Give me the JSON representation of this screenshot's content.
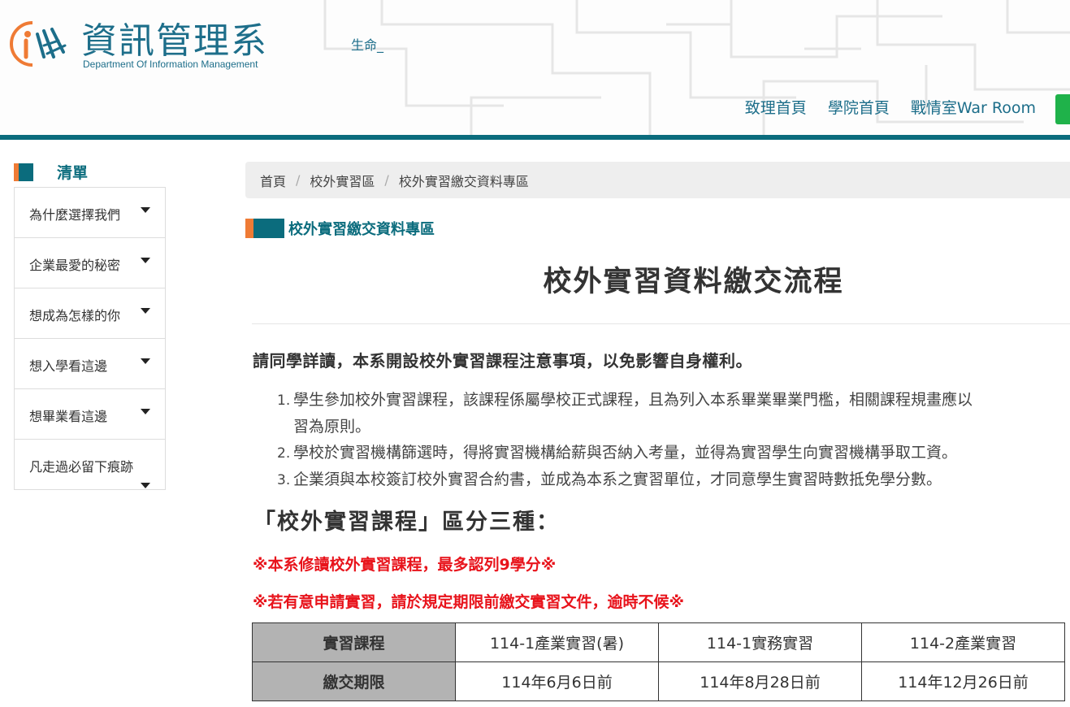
{
  "header": {
    "logo_title": "資訊管理系",
    "logo_subtitle": "Department Of Information Management",
    "marquee": "生命_",
    "nav": [
      "致理首頁",
      "學院首頁",
      "戰情室War Room"
    ],
    "colors": {
      "teal": "#0b6c7d",
      "orange": "#ef7b35",
      "green": "#1fb24a"
    }
  },
  "sidebar": {
    "title": "清單",
    "items": [
      {
        "label": "為什麼選擇我們",
        "icon": "caret-down-icon"
      },
      {
        "label": "企業最愛的秘密",
        "icon": "caret-down-icon"
      },
      {
        "label": "想成為怎樣的你",
        "icon": "caret-down-icon"
      },
      {
        "label": "想入學看這邊",
        "icon": "caret-down-icon"
      },
      {
        "label": "想畢業看這邊",
        "icon": "caret-down-icon"
      },
      {
        "label": "凡走過必留下痕跡",
        "icon": "caret-down-icon"
      }
    ]
  },
  "breadcrumb": {
    "items": [
      "首頁",
      "校外實習區",
      "校外實習繳交資料專區"
    ],
    "separator": "/"
  },
  "section_title": "校外實習繳交資料專區",
  "main": {
    "title": "校外實習資料繳交流程",
    "intro": "請同學詳讀，本系開設校外實習課程注意事項，以免影響自身權利。",
    "notes": [
      {
        "num": "1.",
        "line1": "學生參加校外實習課程，該課程係屬學校正式課程，且為列入本系畢業畢業門檻，相關課程規畫應以",
        "line2": "習為原則。"
      },
      {
        "num": "2.",
        "line1": "學校於實習機構篩選時，得將實習機構給薪與否納入考量，並得為實習學生向實習機構爭取工資。"
      },
      {
        "num": "3.",
        "line1": "企業須與本校簽訂校外實習合約書，並成為本系之實習單位，才同意學生實習時數抵免學分數。"
      }
    ],
    "subheading": "「校外實習課程」區分三種：",
    "warning1": "※本系修讀校外實習課程，最多認列9學分※",
    "warning2": "※若有意申請實習，請於規定期限前繳交實習文件，逾時不候※",
    "warning_color": "#e8131b"
  },
  "schedule_table": {
    "rows": [
      {
        "header": "實習課程",
        "cells": [
          "114-1產業實習(暑)",
          "114-1實務實習",
          "114-2產業實習"
        ]
      },
      {
        "header": "繳交期限",
        "cells": [
          "114年6月6日前",
          "114年8月28日前",
          "114年12月26日前"
        ]
      }
    ]
  }
}
